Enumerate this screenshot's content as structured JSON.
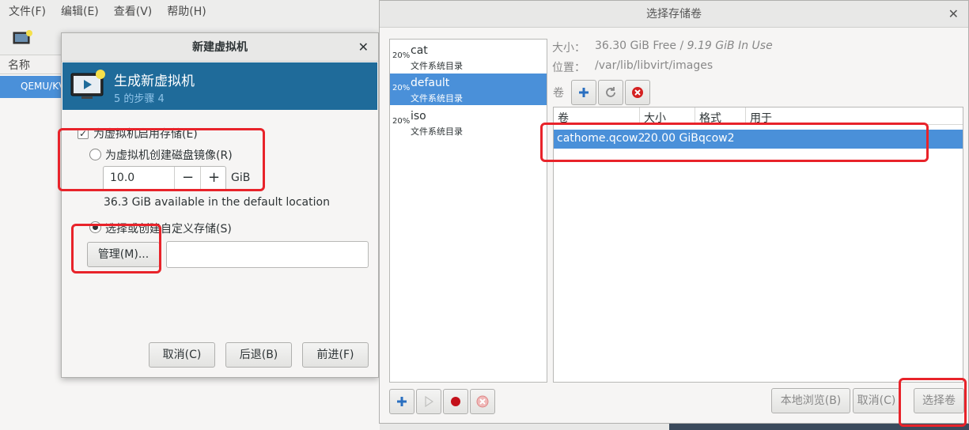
{
  "main_window": {
    "menu": [
      "文件(F)",
      "编辑(E)",
      "查看(V)",
      "帮助(H)"
    ],
    "list_header": "名称",
    "list_row": "QEMU/KVM"
  },
  "new_vm_dialog": {
    "title": "新建虚拟机",
    "banner_title": "生成新虚拟机",
    "banner_step": "5 的步骤 4",
    "enable_storage_label": "为虚拟机启用存储(E)",
    "create_disk_label": "为虚拟机创建磁盘镜像(R)",
    "disk_size_value": "10.0",
    "disk_size_unit": "GiB",
    "available_text": "36.3 GiB available in the default location",
    "custom_storage_label": "选择或创建自定义存储(S)",
    "manage_button": "管理(M)...",
    "cancel_button": "取消(C)",
    "back_button": "后退(B)",
    "forward_button": "前进(F)",
    "enable_storage_checked": true,
    "selected_option": "custom"
  },
  "volume_dialog": {
    "title": "选择存储卷",
    "pools": [
      {
        "percent": "20%",
        "name": "cat",
        "type": "文件系统目录"
      },
      {
        "percent": "20%",
        "name": "default",
        "type": "文件系统目录"
      },
      {
        "percent": "20%",
        "name": "iso",
        "type": "文件系统目录"
      }
    ],
    "selected_pool": "default",
    "size_label": "大小：",
    "size_free": "36.30 GiB Free",
    "size_separator": " / ",
    "size_in_use": "9.19 GiB In Use",
    "location_label": "位置：",
    "location_value": "/var/lib/libvirt/images",
    "volumes_label": "卷",
    "columns": [
      "卷",
      "大小",
      "格式",
      "用于"
    ],
    "rows": [
      {
        "name": "cathome.qcow2",
        "size": "20.00 GiB",
        "format": "qcow2",
        "used_by": ""
      }
    ],
    "browse_local_button": "本地浏览(B)",
    "cancel_button": "取消(C)",
    "choose_button": "选择卷"
  },
  "colors": {
    "selection": "#4a90d9",
    "banner": "#1f6b9a",
    "annotation": "#e8232a"
  }
}
